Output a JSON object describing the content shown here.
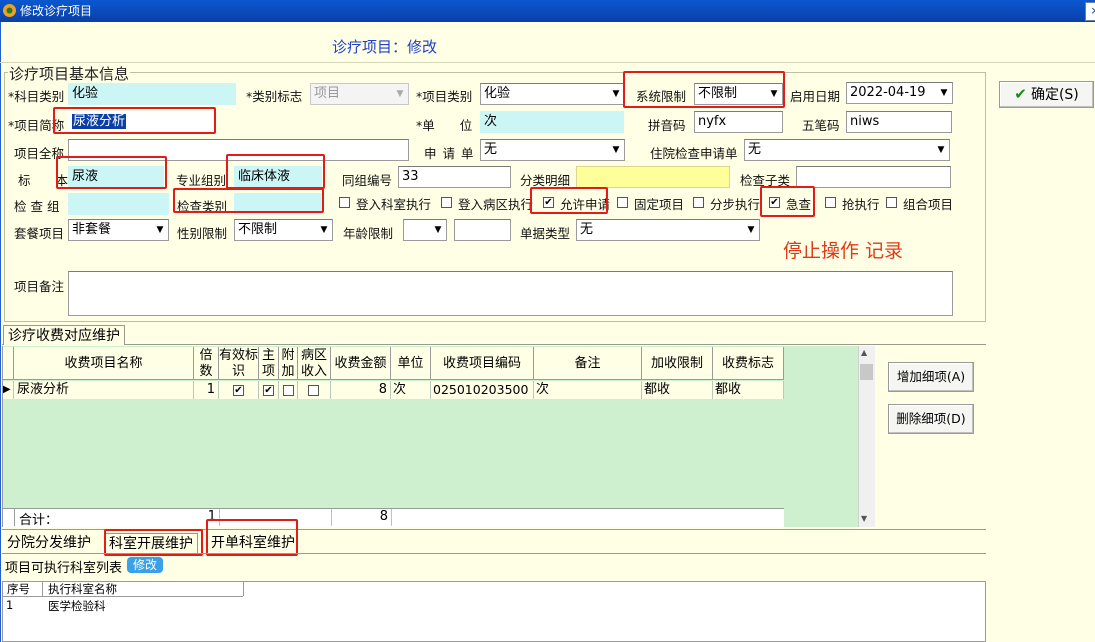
{
  "window": {
    "title": "修改诊疗项目",
    "close_glyph": "×"
  },
  "header": {
    "title": "诊疗项目：修改"
  },
  "basic_group": {
    "legend": "诊疗项目基本信息"
  },
  "form": {
    "subject_category": {
      "label": "*科目类别",
      "value": "化验"
    },
    "category_flag": {
      "label": "*类别标志",
      "value": "项目"
    },
    "item_type": {
      "label": "*项目类别",
      "value": "化验"
    },
    "system_limit": {
      "label": "系统限制",
      "value": "不限制"
    },
    "start_date": {
      "label": "启用日期",
      "value": "2022-04-19"
    },
    "short_name": {
      "label": "*项目简称",
      "value": "尿液分析"
    },
    "unit": {
      "label": "*单　　位",
      "value": "次"
    },
    "pinyin": {
      "label": "拼音码",
      "value": "nyfx"
    },
    "wubi": {
      "label": "五笔码",
      "value": "niws"
    },
    "full_name": {
      "label": "项目全称",
      "value": ""
    },
    "apply_form": {
      "label": "申 请 单",
      "value": "无"
    },
    "inpatient_apply": {
      "label": "住院检查申请单",
      "value": "无"
    },
    "specimen": {
      "label": "标　　本",
      "value": "尿液"
    },
    "specialty_group": {
      "label": "专业组别",
      "value": "临床体液"
    },
    "group_no": {
      "label": "同组编号",
      "value": "33"
    },
    "category_detail": {
      "label": "分类明细",
      "value": ""
    },
    "check_subtype": {
      "label": "检查子类",
      "value": ""
    },
    "check_group": {
      "label": "检 查 组",
      "value": ""
    },
    "check_category": {
      "label": "检查类别",
      "value": ""
    },
    "package_item": {
      "label": "套餐项目",
      "value": "非套餐"
    },
    "gender_limit": {
      "label": "性别限制",
      "value": "不限制"
    },
    "age_limit": {
      "label": "年龄限制",
      "value": ""
    },
    "bill_type": {
      "label": "单据类型",
      "value": "无"
    },
    "remark": {
      "label": "项目备注",
      "value": ""
    }
  },
  "checkboxes": [
    {
      "label": "登入科室执行",
      "checked": false
    },
    {
      "label": "登入病区执行",
      "checked": false
    },
    {
      "label": "允许申请",
      "checked": true
    },
    {
      "label": "固定项目",
      "checked": false
    },
    {
      "label": "分步执行",
      "checked": false
    },
    {
      "label": "急查",
      "checked": true
    },
    {
      "label": "抢执行",
      "checked": false
    },
    {
      "label": "组合项目",
      "checked": false
    }
  ],
  "annotation": {
    "text": "停止操作 记录"
  },
  "buttons": {
    "confirm": "确定(S)",
    "add_item": "增加细项(A)",
    "delete_item": "删除细项(D)"
  },
  "fee_tab": {
    "label": "诊疗收费对应维护"
  },
  "grid": {
    "headers": [
      "收费项目名称",
      "倍数",
      "有效标识",
      "主项",
      "附加",
      "病区收入",
      "收费金额",
      "单位",
      "收费项目编码",
      "备注",
      "加收限制",
      "收费标志"
    ],
    "rows": [
      {
        "name": "尿液分析",
        "multiple": "1",
        "valid": true,
        "main": true,
        "extra": false,
        "ward_income": false,
        "amount": "8",
        "unit": "次",
        "code": "025010203500",
        "note": "次",
        "surcharge_limit": "都收",
        "charge_flag": "都收"
      }
    ],
    "total_label": "合计：",
    "total_multiple": "1",
    "total_amount": "8"
  },
  "bottom_tabs": [
    {
      "label": "分院分发维护",
      "active": false
    },
    {
      "label": "科室开展维护",
      "active": true
    },
    {
      "label": "开单科室维护",
      "active": false
    }
  ],
  "dept_list": {
    "title": "项目可执行科室列表",
    "modify_badge": "修改",
    "headers": [
      "序号",
      "执行科室名称"
    ],
    "rows": [
      {
        "no": "1",
        "name": "医学检验科"
      }
    ]
  },
  "colors": {
    "titlebar": "#0A3FA8",
    "panel_bg": "#FFFFE6",
    "grid_bg": "#CFF0CF",
    "highlight_border": "#E21B1B",
    "annotation": "#E03A1A",
    "header_title": "#2040C8"
  }
}
